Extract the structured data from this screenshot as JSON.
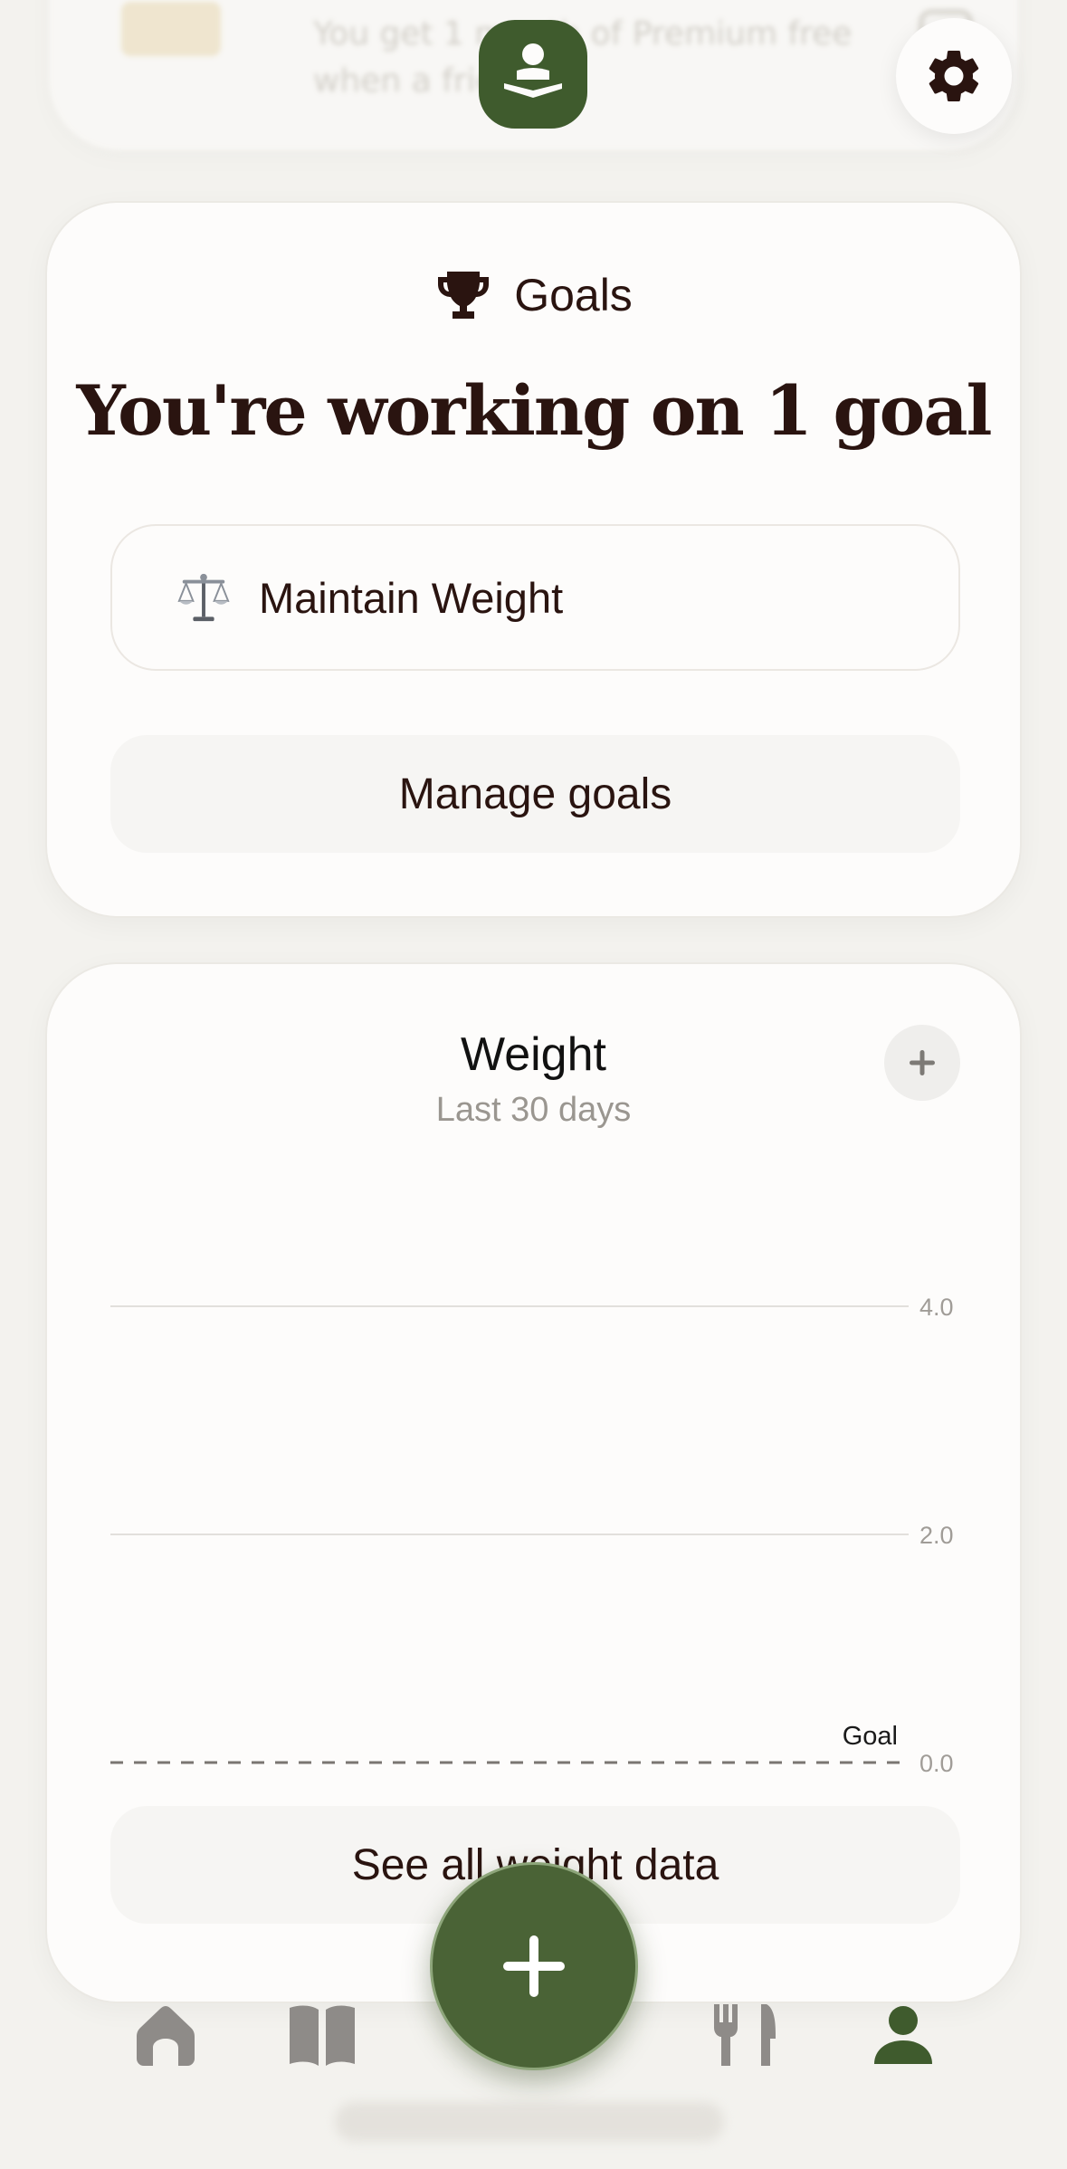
{
  "referral": {
    "text": "You get 1 month of Premium free when a friend",
    "icon": "gift-icon"
  },
  "header": {
    "logo_icon": "reader-logo-icon",
    "settings_icon": "gear-icon"
  },
  "goals": {
    "header_label": "Goals",
    "header_icon": "trophy-icon",
    "title": "You're working on 1 goal",
    "items": [
      {
        "emoji": "⚖️",
        "label": "Maintain Weight"
      }
    ],
    "manage_label": "Manage goals"
  },
  "weight": {
    "title": "Weight",
    "subtitle": "Last 30 days",
    "add_icon": "plus-icon",
    "see_all_label": "See all weight data"
  },
  "chart_data": {
    "type": "line",
    "y_ticks": [
      "4.0",
      "2.0",
      "0.0"
    ],
    "ylim": [
      0,
      4
    ],
    "goal": {
      "label": "Goal",
      "value": 0
    },
    "series": [],
    "grid": true
  },
  "nav": {
    "items": [
      {
        "name": "home",
        "icon": "home-icon",
        "active": false
      },
      {
        "name": "journal",
        "icon": "book-icon",
        "active": false
      },
      {
        "name": "food",
        "icon": "fork-knife-icon",
        "active": false
      },
      {
        "name": "profile",
        "icon": "person-icon",
        "active": true
      }
    ],
    "fab_icon": "plus-icon"
  },
  "colors": {
    "brand_green": "#3f5b2d",
    "text_dark": "#2a1410",
    "nav_inactive": "#8e8b88"
  }
}
